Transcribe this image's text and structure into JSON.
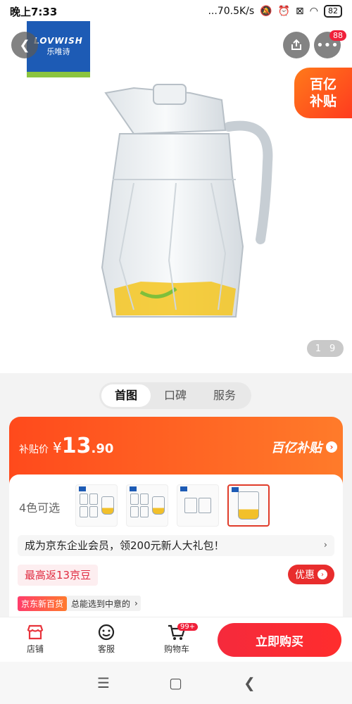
{
  "status_bar": {
    "time": "晚上7:33",
    "network": "...70.5K/s",
    "battery": "82"
  },
  "header": {
    "brand_logo_text_en": "LOVWISH",
    "brand_logo_text_cn": "乐唯诗",
    "notification_count": "88",
    "subsidy_tag_line1": "百亿",
    "subsidy_tag_line2": "补贴"
  },
  "gallery": {
    "current": "1",
    "total": "9"
  },
  "tabs": [
    {
      "label": "首图",
      "active": true
    },
    {
      "label": "口碑",
      "active": false
    },
    {
      "label": "服务",
      "active": false
    }
  ],
  "price": {
    "label": "补贴价",
    "currency": "¥",
    "integer": "13",
    "decimal": ".90",
    "banner": "百亿补贴"
  },
  "variants": {
    "label": "4色可选",
    "count": 4,
    "selected_index": 3
  },
  "member": {
    "text": "成为京东企业会员，领200元新人大礼包！"
  },
  "beans": {
    "text": "最高返13京豆"
  },
  "coupon": {
    "label": "优惠"
  },
  "department_store": {
    "badge": "京东新百货",
    "text": "总能选到中意的"
  },
  "action_bar": {
    "store": "店铺",
    "service": "客服",
    "cart": "购物车",
    "cart_badge": "99+",
    "buy": "立即购买"
  },
  "colors": {
    "accent": "#ff4a1c",
    "buy_button": "#f52a3c"
  }
}
